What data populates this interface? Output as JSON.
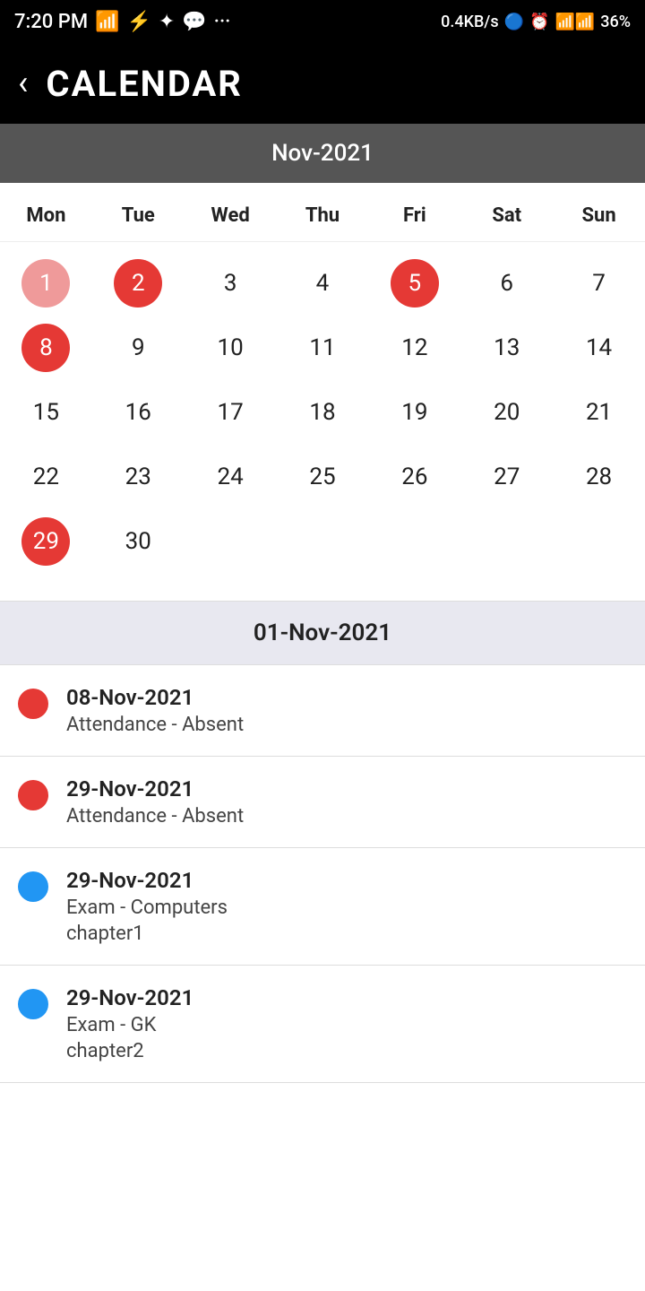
{
  "statusBar": {
    "time": "7:20 PM",
    "network": "0.4KB/s",
    "battery": "36%"
  },
  "header": {
    "title": "CALENDAR",
    "backLabel": "‹"
  },
  "calendar": {
    "monthLabel": "Nov-2021",
    "dayHeaders": [
      "Mon",
      "Tue",
      "Wed",
      "Thu",
      "Fri",
      "Sat",
      "Sun"
    ],
    "weeks": [
      [
        {
          "day": 1,
          "style": "red-light"
        },
        {
          "day": 2,
          "style": "red"
        },
        {
          "day": 3,
          "style": "normal"
        },
        {
          "day": 4,
          "style": "normal"
        },
        {
          "day": 5,
          "style": "red"
        },
        {
          "day": 6,
          "style": "normal"
        },
        {
          "day": 7,
          "style": "normal"
        }
      ],
      [
        {
          "day": 8,
          "style": "red"
        },
        {
          "day": 9,
          "style": "normal"
        },
        {
          "day": 10,
          "style": "normal"
        },
        {
          "day": 11,
          "style": "normal"
        },
        {
          "day": 12,
          "style": "normal"
        },
        {
          "day": 13,
          "style": "normal"
        },
        {
          "day": 14,
          "style": "normal"
        }
      ],
      [
        {
          "day": 15,
          "style": "normal"
        },
        {
          "day": 16,
          "style": "normal"
        },
        {
          "day": 17,
          "style": "normal"
        },
        {
          "day": 18,
          "style": "normal"
        },
        {
          "day": 19,
          "style": "normal"
        },
        {
          "day": 20,
          "style": "normal"
        },
        {
          "day": 21,
          "style": "normal"
        }
      ],
      [
        {
          "day": 22,
          "style": "normal"
        },
        {
          "day": 23,
          "style": "normal"
        },
        {
          "day": 24,
          "style": "normal"
        },
        {
          "day": 25,
          "style": "normal"
        },
        {
          "day": 26,
          "style": "normal"
        },
        {
          "day": 27,
          "style": "normal"
        },
        {
          "day": 28,
          "style": "normal"
        }
      ],
      [
        {
          "day": 29,
          "style": "red"
        },
        {
          "day": 30,
          "style": "normal"
        },
        {
          "day": "",
          "style": "empty"
        },
        {
          "day": "",
          "style": "empty"
        },
        {
          "day": "",
          "style": "empty"
        },
        {
          "day": "",
          "style": "empty"
        },
        {
          "day": "",
          "style": "empty"
        }
      ]
    ]
  },
  "eventsHeader": "01-Nov-2021",
  "events": [
    {
      "dotColor": "red",
      "date": "08-Nov-2021",
      "title": "Attendance - Absent",
      "sub": ""
    },
    {
      "dotColor": "red",
      "date": "29-Nov-2021",
      "title": "Attendance - Absent",
      "sub": ""
    },
    {
      "dotColor": "blue",
      "date": "29-Nov-2021",
      "title": "Exam - Computers",
      "sub": "chapter1"
    },
    {
      "dotColor": "blue",
      "date": "29-Nov-2021",
      "title": "Exam - GK",
      "sub": "chapter2"
    }
  ]
}
